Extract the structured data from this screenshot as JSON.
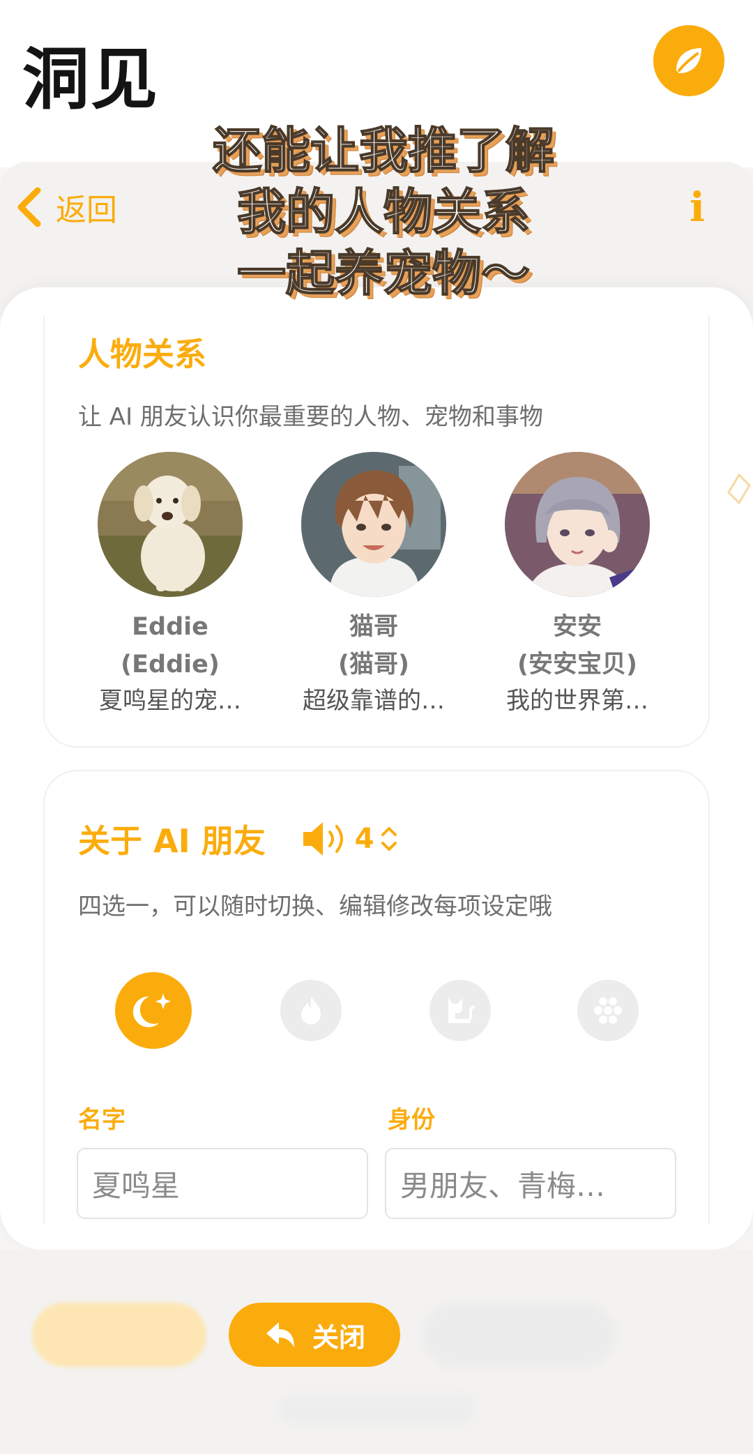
{
  "app": {
    "logo_text": "洞见"
  },
  "colors": {
    "accent": "#fbac0d",
    "caption_shadow": "#e8a058"
  },
  "nav": {
    "back_label": "返回",
    "info_label": "i"
  },
  "caption": {
    "lines": [
      "还能让我推了解",
      "我的人物关系",
      "一起养宠物～"
    ]
  },
  "relations": {
    "title": "人物关系",
    "subtitle": "让 AI 朋友认识你最重要的人物、宠物和事物",
    "contacts": [
      {
        "name": "Eddie",
        "alias": "(Eddie)",
        "desc": "夏鸣星的宠…",
        "avatar": "dog-photo"
      },
      {
        "name": "猫哥",
        "alias": "(猫哥)",
        "desc": "超级靠谱的…",
        "avatar": "anime-boy"
      },
      {
        "name": "安安",
        "alias": "(安安宝贝)",
        "desc": "我的世界第…",
        "avatar": "anime-girl"
      }
    ]
  },
  "about": {
    "title": "关于 AI 朋友",
    "voice_level": "4",
    "subtitle": "四选一，可以随时切换、编辑修改每项设定哦",
    "roles": [
      {
        "icon": "moon-star-icon",
        "active": true
      },
      {
        "icon": "fire-icon",
        "active": false
      },
      {
        "icon": "cat-icon",
        "active": false
      },
      {
        "icon": "honeycomb-icon",
        "active": false
      }
    ],
    "name_label": "名字",
    "name_value": "夏鸣星",
    "identity_label": "身份",
    "identity_value": "男朋友、青梅…"
  },
  "footer": {
    "close_label": "关闭"
  }
}
